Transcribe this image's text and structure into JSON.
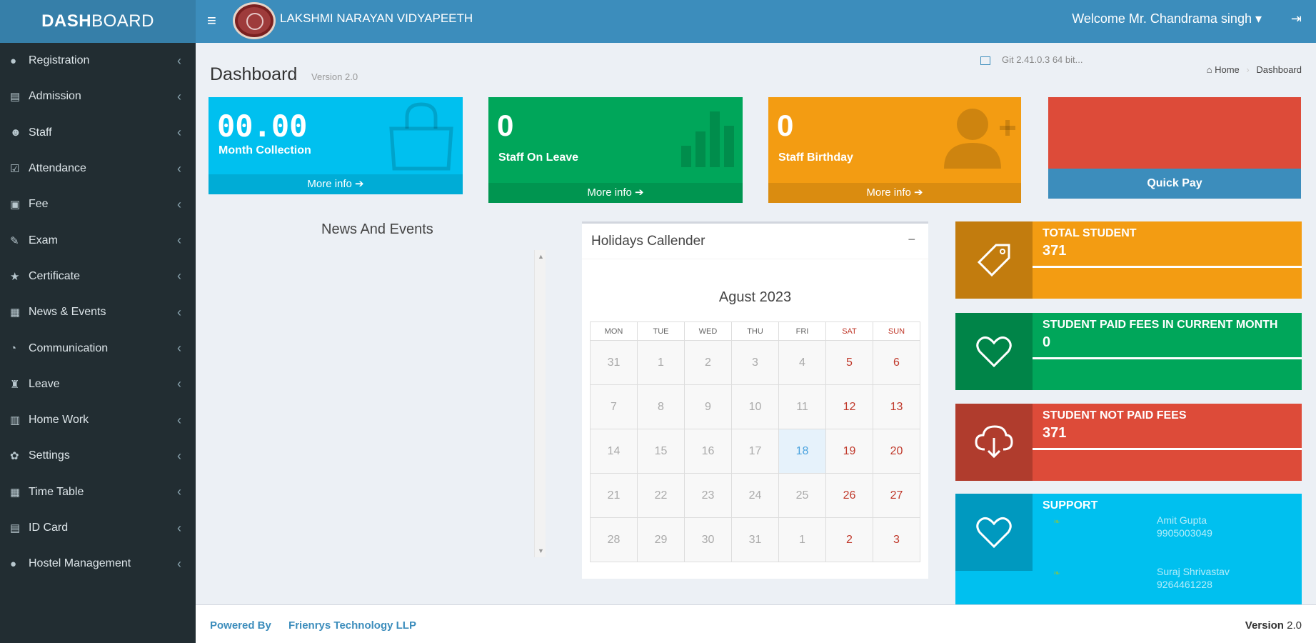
{
  "header": {
    "logo_bold": "DASH",
    "logo_thin": "BOARD",
    "school_name": "LAKSHMI NARAYAN VIDYAPEETH",
    "welcome": "Welcome Mr. Chandrama singh ▾"
  },
  "sidebar": {
    "items": [
      {
        "label": "Registration",
        "icon": "user-icon"
      },
      {
        "label": "Admission",
        "icon": "id-card-icon"
      },
      {
        "label": "Staff",
        "icon": "users-icon"
      },
      {
        "label": "Attendance",
        "icon": "checkbox-icon"
      },
      {
        "label": "Fee",
        "icon": "money-icon"
      },
      {
        "label": "Exam",
        "icon": "edit-icon"
      },
      {
        "label": "Certificate",
        "icon": "star-icon"
      },
      {
        "label": "News & Events",
        "icon": "newspaper-icon"
      },
      {
        "label": "Communication",
        "icon": "comments-icon"
      },
      {
        "label": "Leave",
        "icon": "walking-icon"
      },
      {
        "label": "Home Work",
        "icon": "book-icon"
      },
      {
        "label": "Settings",
        "icon": "gear-icon"
      },
      {
        "label": "Time Table",
        "icon": "table-icon"
      },
      {
        "label": "ID Card",
        "icon": "id-badge-icon"
      },
      {
        "label": "Hostel Management",
        "icon": "user-icon"
      }
    ]
  },
  "content": {
    "title": "Dashboard",
    "version": "Version 2.0",
    "git_info": "Git 2.41.0.3 64 bit...",
    "breadcrumb_home": "Home",
    "breadcrumb_current": "Dashboard"
  },
  "small_boxes": {
    "collection": {
      "value": "00.00",
      "label": "Month Collection",
      "footer": "More info ➔"
    },
    "leave": {
      "value": "0",
      "label": "Staff On Leave",
      "footer": "More info ➔"
    },
    "birthday": {
      "value": "0",
      "label": "Staff Birthday",
      "footer": "More info ➔"
    },
    "quick_pay": {
      "label": "Quick Pay"
    }
  },
  "news": {
    "title": "News And Events"
  },
  "calendar": {
    "title": "Holidays Callender",
    "month": "Agust 2023",
    "days": [
      "MON",
      "TUE",
      "WED",
      "THU",
      "FRI",
      "SAT",
      "SUN"
    ],
    "weeks": [
      [
        "31",
        "1",
        "2",
        "3",
        "4",
        "5",
        "6"
      ],
      [
        "7",
        "8",
        "9",
        "10",
        "11",
        "12",
        "13"
      ],
      [
        "14",
        "15",
        "16",
        "17",
        "18",
        "19",
        "20"
      ],
      [
        "21",
        "22",
        "23",
        "24",
        "25",
        "26",
        "27"
      ],
      [
        "28",
        "29",
        "30",
        "31",
        "1",
        "2",
        "3"
      ]
    ],
    "today": "18"
  },
  "info_boxes": {
    "total_student": {
      "label": "TOTAL STUDENT",
      "value": "371",
      "progress": 1.0
    },
    "paid_fees": {
      "label": "STUDENT PAID FEES IN CURRENT MONTH",
      "value": "0",
      "progress": 1.0
    },
    "not_paid": {
      "label": "STUDENT NOT PAID FEES",
      "value": "371",
      "progress": 1.0
    },
    "support": {
      "label": "SUPPORT",
      "contacts": [
        {
          "name": "Amit Gupta",
          "phone": "9905003049"
        },
        {
          "name": "Suraj Shrivastav",
          "phone": "9264461228"
        }
      ]
    }
  },
  "footer": {
    "powered_by": "Powered By",
    "company": "Frienrys Technology LLP",
    "version_label": "Version",
    "version_num": "2.0"
  },
  "colors": {
    "header": "#3c8dbc",
    "sidebar": "#222d32",
    "aqua": "#00c0ef",
    "green": "#00a65a",
    "yellow": "#f39c12",
    "red": "#dd4b39"
  }
}
